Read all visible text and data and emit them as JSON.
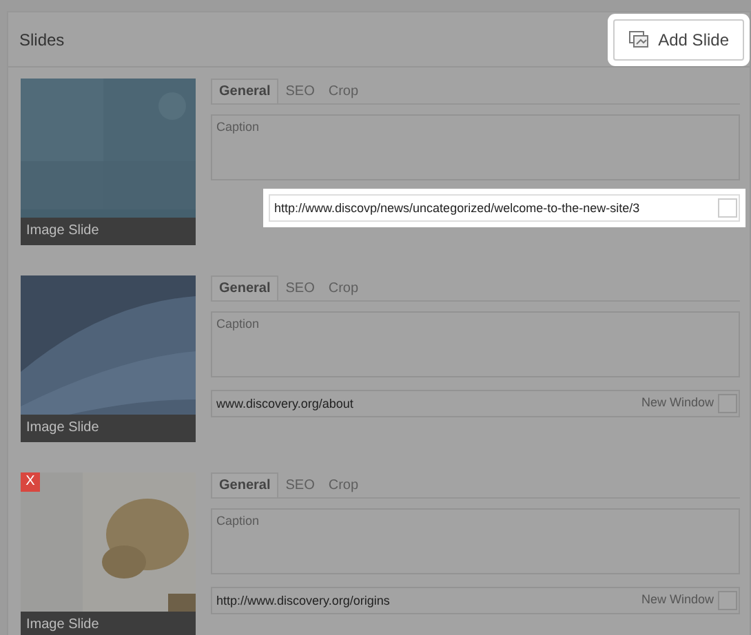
{
  "panel": {
    "title": "Slides"
  },
  "add_button": {
    "label": "Add Slide",
    "highlighted": true
  },
  "slides": [
    {
      "type_label": "Image Slide",
      "tabs": [
        {
          "label": "General",
          "selected": true
        },
        {
          "label": "SEO",
          "selected": false
        },
        {
          "label": "Crop",
          "selected": false
        }
      ],
      "caption": {
        "placeholder": "Caption"
      },
      "url": {
        "value": "http://www.discovp/news/uncategorized/welcome-to-the-new-site/3",
        "highlighted": true
      },
      "new_window": {
        "checked": false
      }
    },
    {
      "type_label": "Image Slide",
      "tabs": [
        {
          "label": "General",
          "selected": true
        },
        {
          "label": "SEO",
          "selected": false
        },
        {
          "label": "Crop",
          "selected": false
        }
      ],
      "caption": {
        "placeholder": "Caption"
      },
      "url": {
        "value": "www.discovery.org/about",
        "highlighted": false
      },
      "new_window": {
        "label": "New Window",
        "checked": false
      }
    },
    {
      "type_label": "Image Slide",
      "delete_button": "X",
      "tabs": [
        {
          "label": "General",
          "selected": true
        },
        {
          "label": "SEO",
          "selected": false
        },
        {
          "label": "Crop",
          "selected": false
        }
      ],
      "caption": {
        "placeholder": "Caption"
      },
      "url": {
        "value": "http://www.discovery.org/origins",
        "highlighted": false
      },
      "new_window": {
        "label": "New Window",
        "checked": false
      }
    }
  ]
}
